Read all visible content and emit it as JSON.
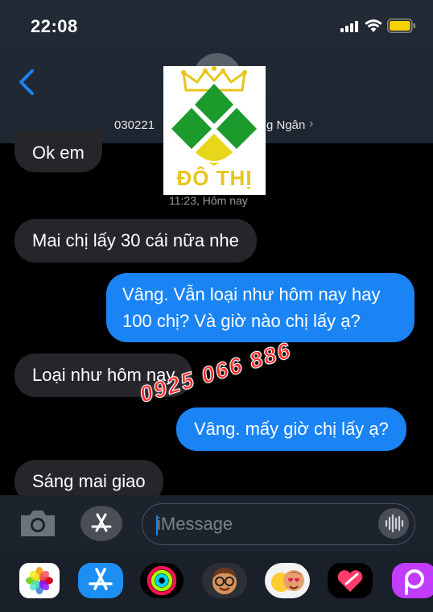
{
  "status_bar": {
    "time": "22:08"
  },
  "header": {
    "contact_name_start": "030221",
    "contact_name_end": "g Ngân",
    "chevron": "›"
  },
  "logo": {
    "text": "ĐÔ THỊ"
  },
  "thread": {
    "timestamp": "11:23, Hôm nay",
    "messages": [
      {
        "direction": "incoming",
        "text": "Ok em"
      },
      {
        "direction": "incoming",
        "text": "Mai chị lấy 30 cái nữa nhe"
      },
      {
        "direction": "outgoing",
        "text": "Vâng. Vẫn loại như hôm nay hay 100 chị? Và giờ nào chị lấy ạ?"
      },
      {
        "direction": "incoming",
        "text": "Loại như hôm nay"
      },
      {
        "direction": "outgoing",
        "text": "Vâng. mấy giờ chị lấy ạ?"
      },
      {
        "direction": "incoming",
        "text": "Sáng mai giao"
      }
    ]
  },
  "watermark": {
    "phone": "0925 066 886"
  },
  "input": {
    "placeholder": "iMessage"
  },
  "apps": [
    "photos-icon",
    "app-store-icon",
    "activity-icon",
    "memoji-icon",
    "memoji-stickers-icon",
    "digital-touch-icon",
    "picsart-icon"
  ],
  "colors": {
    "outgoing_bubble": "#1a84f5",
    "incoming_bubble": "#26252a",
    "battery": "#f7d000",
    "watermark": "#ff2525"
  }
}
